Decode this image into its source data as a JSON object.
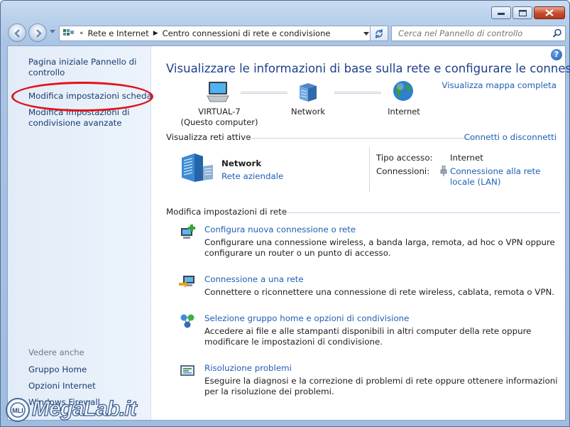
{
  "address": {
    "crumbs": [
      "Rete e Internet",
      "Centro connessioni di rete e condivisione"
    ]
  },
  "search": {
    "placeholder": "Cerca nel Pannello di controllo"
  },
  "sidebar": {
    "items": [
      {
        "label": "Pagina iniziale Pannello di controllo"
      },
      {
        "label": "Modifica impostazioni scheda"
      },
      {
        "label": "Modifica impostazioni di condivisione avanzate"
      }
    ],
    "see_also_header": "Vedere anche",
    "see_also": [
      {
        "label": "Gruppo Home"
      },
      {
        "label": "Opzioni Internet"
      },
      {
        "label": "Windows Firewall"
      }
    ]
  },
  "main": {
    "title": "Visualizzare le informazioni di base sulla rete e configurare le connessioni",
    "map_link": "Visualizza mappa completa",
    "map": {
      "computer": "VIRTUAL-7",
      "computer_sub": "(Questo computer)",
      "network": "Network",
      "internet": "Internet"
    },
    "active": {
      "header": "Visualizza reti attive",
      "link": "Connetti o disconnetti",
      "name": "Network",
      "type": "Rete aziendale",
      "access_label": "Tipo accesso:",
      "access_value": "Internet",
      "conn_label": "Connessioni:",
      "conn_value": "Connessione alla rete locale (LAN)"
    },
    "settings_header": "Modifica impostazioni di rete",
    "tasks": [
      {
        "label": "Configura nuova connessione o rete",
        "desc": "Configurare una connessione wireless, a banda larga, remota, ad hoc o VPN oppure configurare un router o un punto di accesso."
      },
      {
        "label": "Connessione a una rete",
        "desc": "Connettere o riconnettere una connessione di rete wireless, cablata, remota o VPN."
      },
      {
        "label": "Selezione gruppo home e opzioni di condivisione",
        "desc": "Accedere ai file e alle stampanti disponibili in altri computer della rete oppure modificare le impostazioni di condivisione."
      },
      {
        "label": "Risoluzione problemi",
        "desc": "Eseguire la diagnosi e la correzione di problemi di rete oppure ottenere informazioni per la risoluzione dei problemi."
      }
    ]
  },
  "watermark": {
    "text": "MegaLab.it",
    "logo": "MLI"
  },
  "colors": {
    "link": "#1f5fb4",
    "title": "#1e3f8a",
    "highlight": "#e2131b"
  },
  "icons": [
    "minimize-icon",
    "maximize-icon",
    "close-icon",
    "back-icon",
    "forward-icon",
    "address-icon",
    "refresh-icon",
    "search-icon",
    "help-icon",
    "computer-icon",
    "network-icon",
    "internet-icon",
    "network-building-icon",
    "lan-icon"
  ]
}
